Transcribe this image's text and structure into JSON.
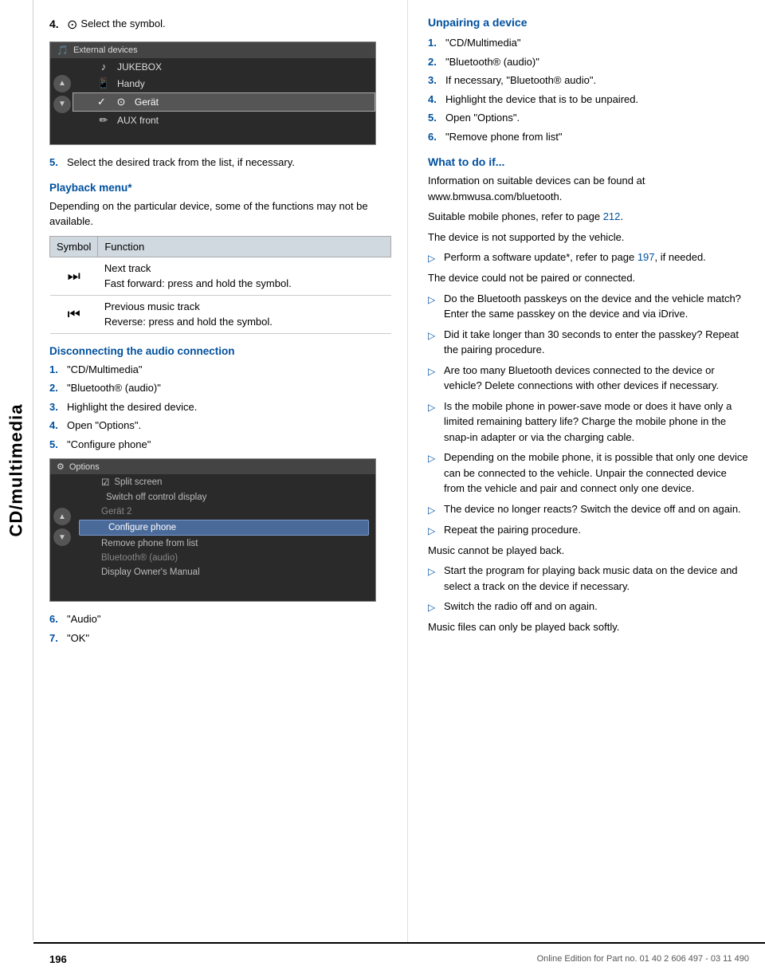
{
  "sidebar": {
    "label": "CD/multimedia"
  },
  "left_col": {
    "step4": {
      "num": "4.",
      "symbol": "⊙",
      "text": "Select the symbol."
    },
    "screenshot1": {
      "title": "External devices",
      "title_icon": "🎵",
      "rows": [
        {
          "icon": "♪",
          "label": "JUKEBOX",
          "selected": false
        },
        {
          "icon": "📱",
          "label": "Handy",
          "selected": false
        },
        {
          "icon": "⊙",
          "label": "Gerät",
          "selected": true
        },
        {
          "icon": "✏",
          "label": "AUX front",
          "selected": false
        }
      ]
    },
    "step5": {
      "num": "5.",
      "text": "Select the desired track from the list, if necessary."
    },
    "playback_menu": {
      "header": "Playback menu*",
      "intro": "Depending on the particular device, some of the functions may not be available.",
      "col1": "Symbol",
      "col2": "Function",
      "rows": [
        {
          "symbol": "⏭",
          "lines": [
            "Next track",
            "Fast forward: press and hold the symbol."
          ]
        },
        {
          "symbol": "⏮",
          "lines": [
            "Previous music track",
            "Reverse: press and hold the symbol."
          ]
        }
      ]
    },
    "disconnecting": {
      "header": "Disconnecting the audio connection",
      "steps": [
        {
          "num": "1.",
          "text": "\"CD/Multimedia\""
        },
        {
          "num": "2.",
          "text": "\"Bluetooth® (audio)\""
        },
        {
          "num": "3.",
          "text": "Highlight the desired device."
        },
        {
          "num": "4.",
          "text": "Open \"Options\"."
        },
        {
          "num": "5.",
          "text": "\"Configure phone\""
        }
      ]
    },
    "screenshot2": {
      "title": "Options",
      "title_icon": "⚙",
      "rows": [
        {
          "label": "Split screen",
          "has_check": true,
          "highlighted": false,
          "grayed": false
        },
        {
          "label": "Switch off control display",
          "has_check": false,
          "highlighted": false,
          "grayed": false
        },
        {
          "label": "Gerät 2",
          "has_check": false,
          "highlighted": false,
          "grayed": true
        },
        {
          "label": "Configure phone",
          "has_check": false,
          "highlighted": true,
          "grayed": false
        },
        {
          "label": "Remove phone from list",
          "has_check": false,
          "highlighted": false,
          "grayed": false
        },
        {
          "label": "Bluetooth® (audio)",
          "has_check": false,
          "highlighted": false,
          "grayed": true
        },
        {
          "label": "Display Owner's Manual",
          "has_check": false,
          "highlighted": false,
          "grayed": false
        }
      ]
    },
    "steps_after": [
      {
        "num": "6.",
        "text": "\"Audio\"",
        "color": "blue"
      },
      {
        "num": "7.",
        "text": "\"OK\"",
        "color": "blue"
      }
    ]
  },
  "right_col": {
    "unpairing": {
      "header": "Unpairing a device",
      "steps": [
        {
          "num": "1.",
          "text": "\"CD/Multimedia\""
        },
        {
          "num": "2.",
          "text": "\"Bluetooth® (audio)\""
        },
        {
          "num": "3.",
          "text": "If necessary, \"Bluetooth® audio\"."
        },
        {
          "num": "4.",
          "text": "Highlight the device that is to be unpaired."
        },
        {
          "num": "5.",
          "text": "Open \"Options\"."
        },
        {
          "num": "6.",
          "text": "\"Remove phone from list\""
        }
      ]
    },
    "what_to_do": {
      "header": "What to do if...",
      "intro1": "Information on suitable devices can be found at www.bmwusa.com/bluetooth.",
      "intro2": "Suitable mobile phones, refer to page ",
      "intro2_link": "212",
      "intro2_end": ".",
      "intro3": "The device is not supported by the vehicle.",
      "bullets": [
        {
          "text": "Perform a software update*, refer to page ",
          "link": "197",
          "link_end": ", if needed."
        },
        {
          "text": "The device could not be paired or connected.",
          "is_header": true
        },
        {
          "text": "Do the Bluetooth passkeys on the device and the vehicle match? Enter the same passkey on the device and via iDrive."
        },
        {
          "text": "Did it take longer than 30 seconds to enter the passkey? Repeat the pairing procedure."
        },
        {
          "text": "Are too many Bluetooth devices connected to the device or vehicle? Delete connections with other devices if necessary."
        },
        {
          "text": "Is the mobile phone in power-save mode or does it have only a limited remaining battery life? Charge the mobile phone in the snap-in adapter or via the charging cable."
        },
        {
          "text": "Depending on the mobile phone, it is possible that only one device can be connected to the vehicle. Unpair the connected device from the vehicle and pair and connect only one device."
        },
        {
          "text": "The device no longer reacts? Switch the device off and on again."
        },
        {
          "text": "Repeat the pairing procedure."
        }
      ],
      "music_header": "Music cannot be played back.",
      "music_bullets": [
        {
          "text": "Start the program for playing back music data on the device and select a track on the device if necessary."
        },
        {
          "text": "Switch the radio off and on again."
        }
      ],
      "footer_note": "Music files can only be played back softly."
    }
  },
  "footer": {
    "page_num": "196",
    "footer_text": "Online Edition for Part no. 01 40 2 606 497 - 03 11 490"
  }
}
